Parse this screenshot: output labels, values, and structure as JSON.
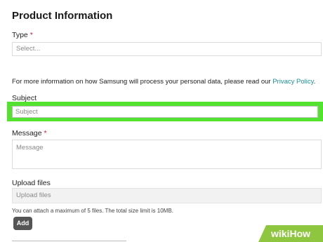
{
  "header": {
    "title": "Product Information"
  },
  "type_field": {
    "label": "Type",
    "required_mark": "*",
    "placeholder": "Select..."
  },
  "privacy": {
    "text": "For more information on how Samsung will process your personal data, please read our ",
    "link_text": "Privacy Policy",
    "suffix": "."
  },
  "subject_field": {
    "label": "Subject",
    "placeholder": "Subject"
  },
  "message_field": {
    "label": "Message",
    "required_mark": "*",
    "placeholder": "Message"
  },
  "upload": {
    "label": "Upload files",
    "placeholder": "Upload files",
    "hint": "You can attach a maximum of 5 files. The total size limit is 10MB.",
    "add_label": "Add"
  },
  "watermark": {
    "wiki": "wiki",
    "how": "How"
  },
  "colors": {
    "highlight": "#53e22f",
    "link": "#1a8f9a",
    "required": "#d02030",
    "watermark": "#8ec63f"
  }
}
